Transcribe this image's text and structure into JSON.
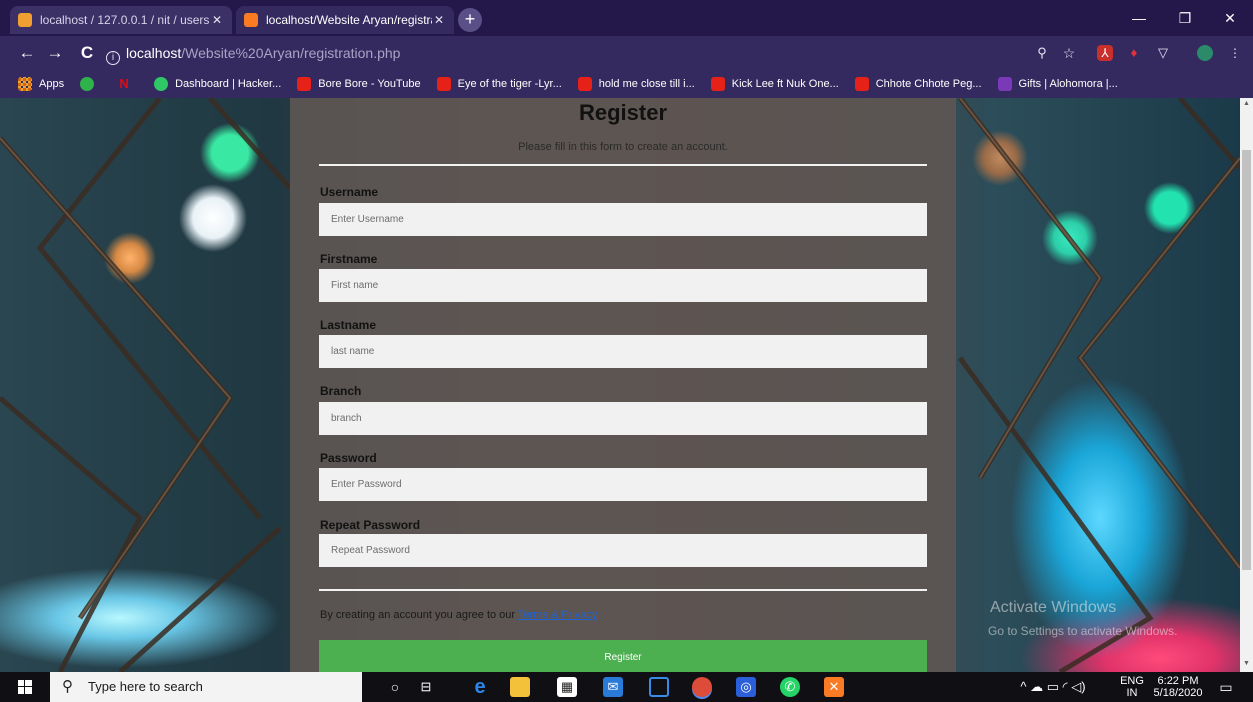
{
  "browser": {
    "tabs": [
      {
        "title": "localhost / 127.0.0.1 / nit / users",
        "close": "✕"
      },
      {
        "title": "localhost/Website Aryan/registra",
        "close": "✕"
      }
    ],
    "new_tab": "+",
    "window_controls": {
      "minimize": "—",
      "restore": "❐",
      "close": "✕"
    },
    "nav": {
      "back": "←",
      "forward": "→",
      "reload": "C"
    },
    "url_host": "localhost",
    "url_path": "/Website%20Aryan/registration.php",
    "bookmarks": [
      {
        "label": "Apps",
        "icon": "apps-grid-icon",
        "color": "#e8a33a"
      },
      {
        "label": "",
        "icon": "play-icon",
        "color": "#2fb24a"
      },
      {
        "label": "",
        "icon": "netflix-icon",
        "color": "#e50914"
      },
      {
        "label": "Dashboard | Hacker...",
        "icon": "hackerrank-icon",
        "color": "#2ec866"
      },
      {
        "label": "Bore Bore - YouTube",
        "icon": "youtube-icon",
        "color": "#e62117"
      },
      {
        "label": "Eye of the tiger -Lyr...",
        "icon": "youtube-icon",
        "color": "#e62117"
      },
      {
        "label": "hold me close till i...",
        "icon": "youtube-icon",
        "color": "#e62117"
      },
      {
        "label": "Kick Lee ft Nuk One...",
        "icon": "youtube-icon",
        "color": "#e62117"
      },
      {
        "label": "Chhote Chhote Peg...",
        "icon": "youtube-icon",
        "color": "#e62117"
      },
      {
        "label": "Gifts | Alohomora |...",
        "icon": "gift-icon",
        "color": "#7a3ab8"
      }
    ]
  },
  "form": {
    "title": "Register",
    "subtitle": "Please fill in this form to create an account.",
    "fields": [
      {
        "label": "Username",
        "placeholder": "Enter Username"
      },
      {
        "label": "Firstname",
        "placeholder": "First name"
      },
      {
        "label": "Lastname",
        "placeholder": "last name"
      },
      {
        "label": "Branch",
        "placeholder": "branch"
      },
      {
        "label": "Password",
        "placeholder": "Enter Password"
      },
      {
        "label": "Repeat Password",
        "placeholder": "Repeat Password"
      }
    ],
    "terms_text": "By creating an account you agree to our ",
    "terms_link": "Terms & Privacy",
    "submit": "Register"
  },
  "watermark": {
    "line1": "Activate Windows",
    "line2": "Go to Settings to activate Windows."
  },
  "taskbar": {
    "search_placeholder": "Type here to search",
    "language": "ENG",
    "region": "IN",
    "time": "6:22 PM",
    "date": "5/18/2020"
  },
  "colors": {
    "register_button": "#4caf50",
    "terms_link": "#1e64d8",
    "browser_frame": "#352a5f"
  }
}
